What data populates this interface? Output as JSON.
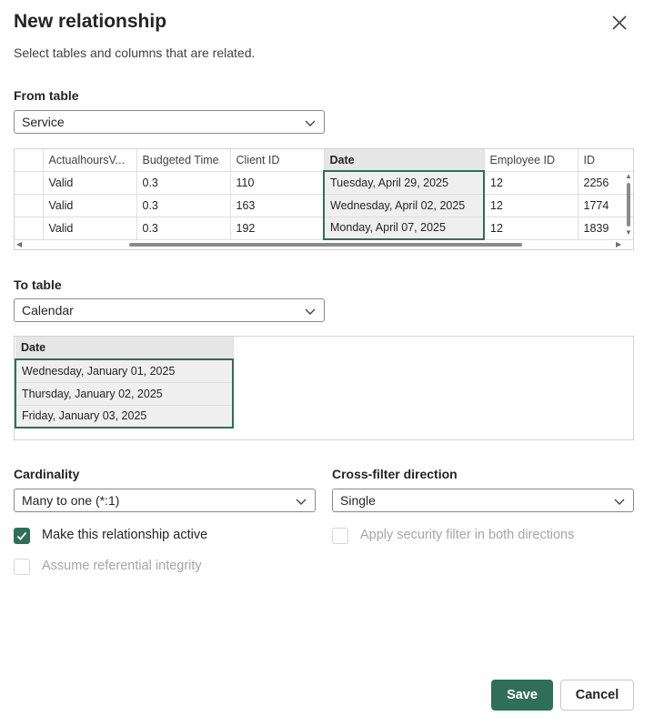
{
  "dialog": {
    "title": "New relationship",
    "subtitle": "Select tables and columns that are related."
  },
  "from_table": {
    "label": "From table",
    "value": "Service",
    "columns": [
      "ActualhoursV...",
      "Budgeted Time",
      "Client ID",
      "Date",
      "Employee ID",
      "ID"
    ],
    "selected_column": "Date",
    "rows": [
      [
        "Valid",
        "0.3",
        "110",
        "Tuesday, April 29, 2025",
        "12",
        "2256"
      ],
      [
        "Valid",
        "0.3",
        "163",
        "Wednesday, April 02, 2025",
        "12",
        "1774"
      ],
      [
        "Valid",
        "0.3",
        "192",
        "Monday, April 07, 2025",
        "12",
        "1839"
      ]
    ]
  },
  "to_table": {
    "label": "To table",
    "value": "Calendar",
    "columns": [
      "Date"
    ],
    "selected_column": "Date",
    "rows": [
      [
        "Wednesday, January 01, 2025"
      ],
      [
        "Thursday, January 02, 2025"
      ],
      [
        "Friday, January 03, 2025"
      ]
    ]
  },
  "cardinality": {
    "label": "Cardinality",
    "value": "Many to one (*:1)"
  },
  "cross_filter": {
    "label": "Cross-filter direction",
    "value": "Single"
  },
  "options": {
    "make_active": {
      "label": "Make this relationship active",
      "checked": true
    },
    "security_filter": {
      "label": "Apply security filter in both directions",
      "checked": false,
      "disabled": true
    },
    "referential_integrity": {
      "label": "Assume referential integrity",
      "checked": false,
      "disabled": true
    }
  },
  "buttons": {
    "save": "Save",
    "cancel": "Cancel"
  },
  "colors": {
    "accent": "#2f6e59",
    "border": "#8a8a8a",
    "selected_header": "#e6e6e6"
  },
  "icons": {
    "close": "close-icon",
    "dropdown": "chevron-down-icon",
    "check": "checkmark-icon"
  }
}
